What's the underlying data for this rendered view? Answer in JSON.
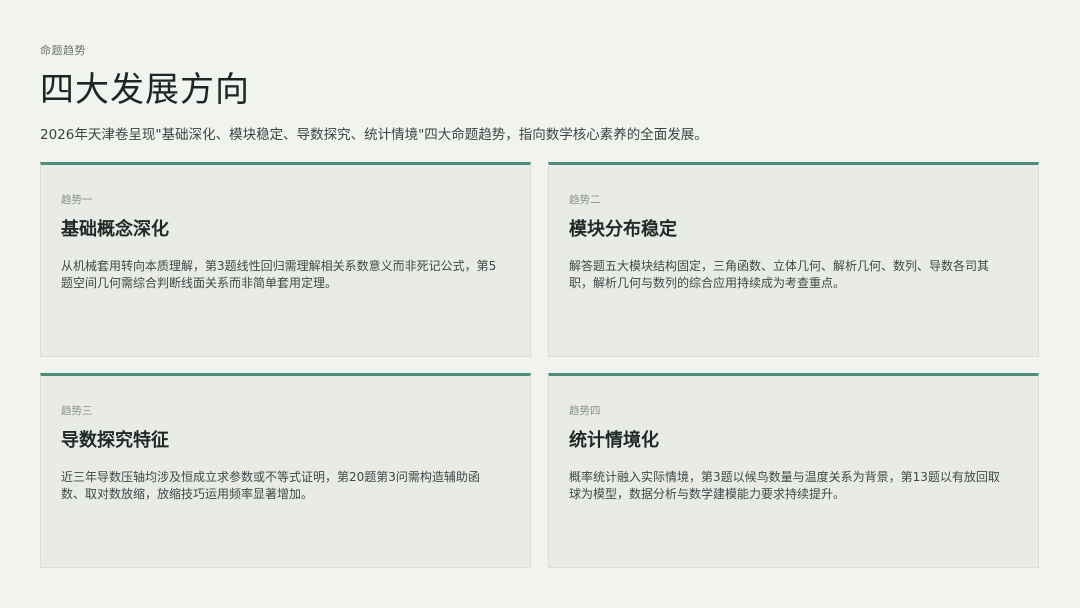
{
  "header": {
    "eyebrow": "命题趋势",
    "title": "四大发展方向",
    "subtitle": "2026年天津卷呈现\"基础深化、模块稳定、导数探究、统计情境\"四大命题趋势，指向数学核心素养的全面发展。"
  },
  "accent_color": "#4d8d7a",
  "cards": [
    {
      "tag": "趋势一",
      "title": "基础概念深化",
      "body": "从机械套用转向本质理解，第3题线性回归需理解相关系数意义而非死记公式，第5题空间几何需综合判断线面关系而非简单套用定理。"
    },
    {
      "tag": "趋势二",
      "title": "模块分布稳定",
      "body": "解答题五大模块结构固定，三角函数、立体几何、解析几何、数列、导数各司其职，解析几何与数列的综合应用持续成为考查重点。"
    },
    {
      "tag": "趋势三",
      "title": "导数探究特征",
      "body": "近三年导数压轴均涉及恒成立求参数或不等式证明，第20题第3问需构造辅助函数、取对数放缩，放缩技巧运用频率显著增加。"
    },
    {
      "tag": "趋势四",
      "title": "统计情境化",
      "body": "概率统计融入实际情境，第3题以候鸟数量与温度关系为背景，第13题以有放回取球为模型，数据分析与数学建模能力要求持续提升。"
    }
  ]
}
